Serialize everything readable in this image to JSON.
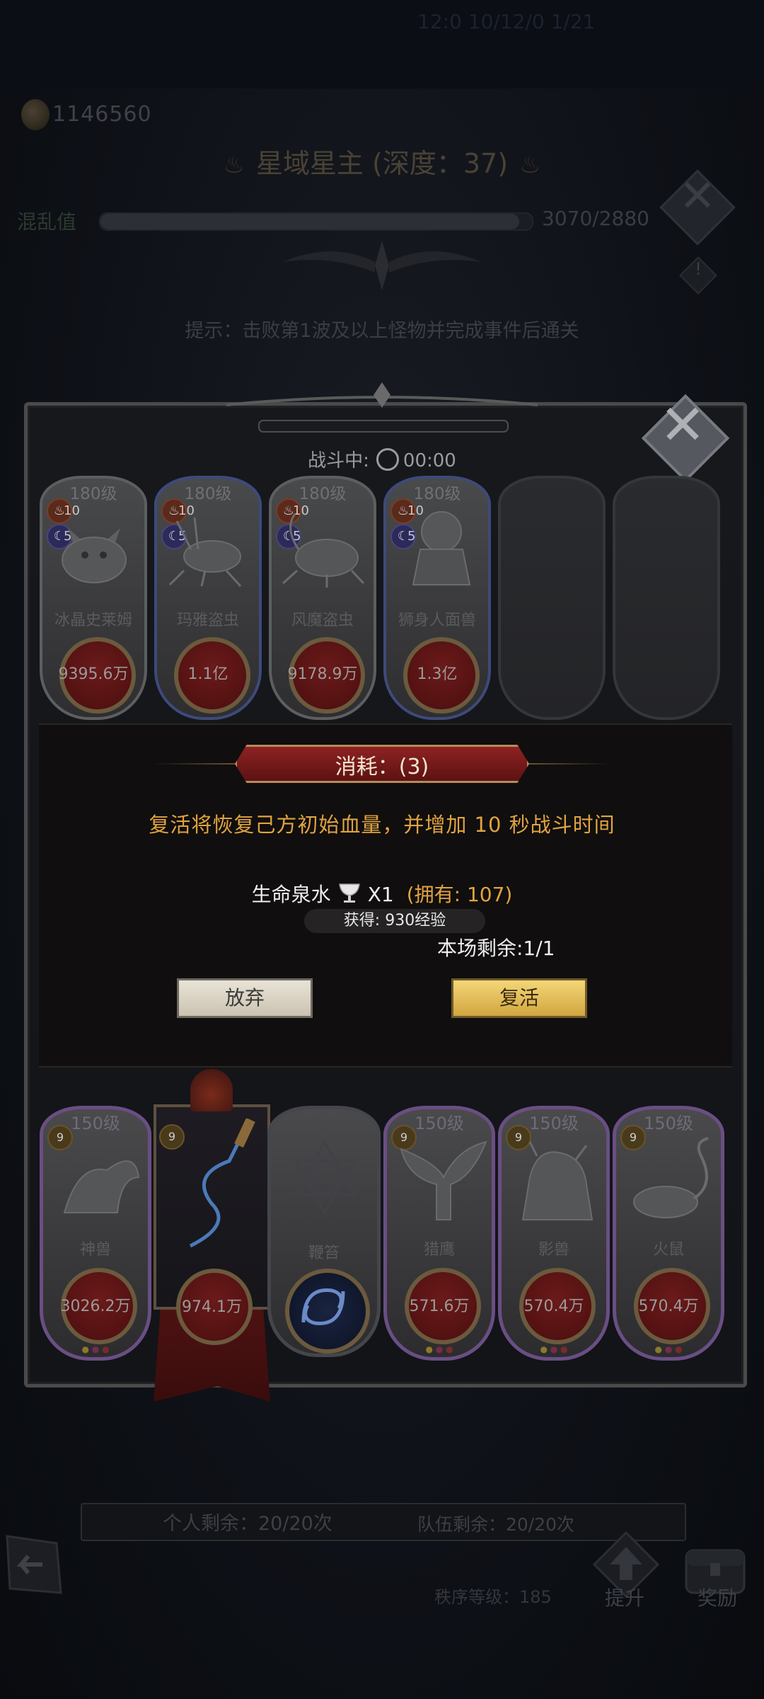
{
  "status_bar": {
    "clock_text": "12:0 10/12/0 1/21"
  },
  "currency": {
    "value": "1146560",
    "icon": "gold-coin-icon"
  },
  "stage": {
    "title": "星域星主 (深度：37)"
  },
  "chaos": {
    "label": "混乱值",
    "value": "3070/2880",
    "fill_fraction": 0.97
  },
  "hint": "提示：击败第1波及以上怪物并完成事件后通关",
  "battle": {
    "status_label": "战斗中:",
    "timer": "00:00"
  },
  "enemies": [
    {
      "level": "180级",
      "fire": "10",
      "moon": "5",
      "name": "冰晶史莱姆",
      "hp": "9395.6万",
      "frame": "gray"
    },
    {
      "level": "180级",
      "fire": "10",
      "moon": "5",
      "name": "玛雅盗虫",
      "hp": "1.1亿",
      "frame": "blue"
    },
    {
      "level": "180级",
      "fire": "10",
      "moon": "5",
      "name": "风魔盗虫",
      "hp": "9178.9万",
      "frame": "gray"
    },
    {
      "level": "180级",
      "fire": "10",
      "moon": "5",
      "name": "狮身人面兽",
      "hp": "1.3亿",
      "frame": "blue"
    }
  ],
  "team": [
    {
      "level": "150级",
      "badge": "9",
      "name": "神兽",
      "hp": "3026.2万"
    },
    {
      "level": "",
      "badge": "9",
      "name": "",
      "hp": "974.1万"
    },
    {
      "level": "",
      "badge": "",
      "name": "鞭笞",
      "hp": ""
    },
    {
      "level": "150级",
      "badge": "9",
      "name": "猎鹰",
      "hp": "571.6万"
    },
    {
      "level": "150级",
      "badge": "9",
      "name": "影兽",
      "hp": "570.4万"
    },
    {
      "level": "150级",
      "badge": "9",
      "name": "火鼠",
      "hp": "570.4万"
    }
  ],
  "modal": {
    "cost_title": "消耗：(3)",
    "description": "复活将恢复己方初始血量，并增加 10 秒战斗时间",
    "item_name": "生命泉水",
    "item_qty": "X1",
    "item_owned": "(拥有: 107)",
    "exp_tip": "获得: 930经验",
    "remaining": "本场剩余:1/1",
    "giveup_label": "放弃",
    "revive_label": "复活"
  },
  "bottom": {
    "personal_left": "个人剩余：20/20次",
    "team_left": "队伍剩余：20/20次",
    "rank_level": "秩序等级：185",
    "upgrade_label": "提升",
    "reward_label": "奖励"
  }
}
